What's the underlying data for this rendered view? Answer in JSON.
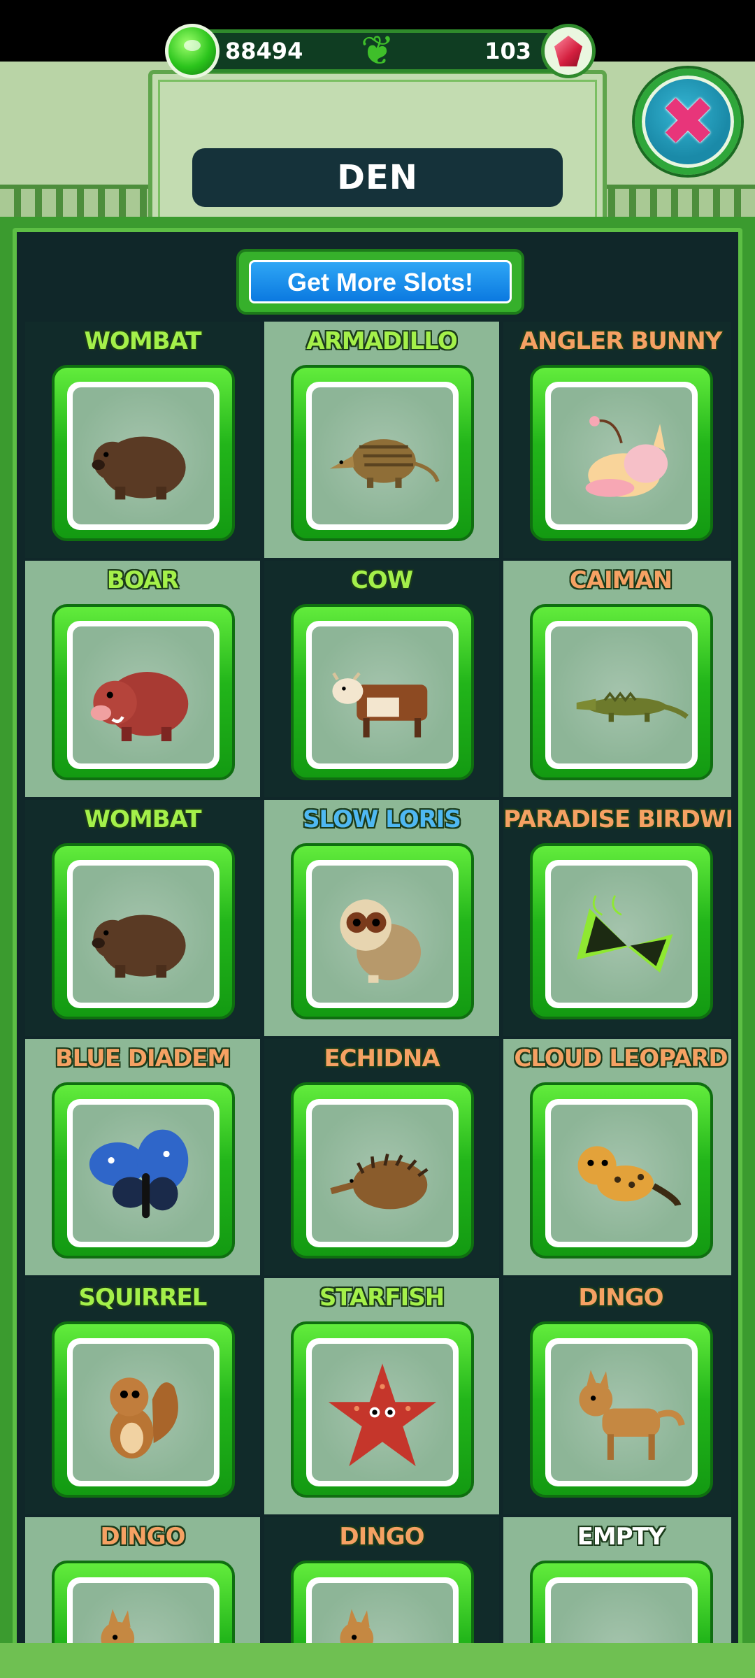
{
  "header": {
    "green_currency": "88494",
    "red_currency": "103",
    "title": "DEN"
  },
  "slots_button_label": "Get More Slots!",
  "animals": [
    {
      "name": "WOMBAT",
      "label_color": "green",
      "tone": "dark",
      "icon": "wombat-icon"
    },
    {
      "name": "ARMADILLO",
      "label_color": "green",
      "tone": "light",
      "icon": "armadillo-icon"
    },
    {
      "name": "ANGLER BUNNY",
      "label_color": "orange",
      "tone": "dark",
      "icon": "angler-bunny-icon"
    },
    {
      "name": "BOAR",
      "label_color": "green",
      "tone": "light",
      "icon": "boar-icon"
    },
    {
      "name": "COW",
      "label_color": "green",
      "tone": "dark",
      "icon": "cow-icon"
    },
    {
      "name": "CAIMAN",
      "label_color": "orange",
      "tone": "light",
      "icon": "caiman-icon"
    },
    {
      "name": "WOMBAT",
      "label_color": "green",
      "tone": "dark",
      "icon": "wombat-icon"
    },
    {
      "name": "SLOW LORIS",
      "label_color": "blue",
      "tone": "light",
      "icon": "slow-loris-icon"
    },
    {
      "name": "PARADISE BIRDWING",
      "label_color": "orange",
      "tone": "dark",
      "icon": "birdwing-icon"
    },
    {
      "name": "BLUE DIADEM",
      "label_color": "orange",
      "tone": "light",
      "icon": "blue-diadem-icon"
    },
    {
      "name": "ECHIDNA",
      "label_color": "orange",
      "tone": "dark",
      "icon": "echidna-icon"
    },
    {
      "name": "CLOUD LEOPARD",
      "label_color": "orange",
      "tone": "light",
      "icon": "cloud-leopard-icon"
    },
    {
      "name": "SQUIRREL",
      "label_color": "green",
      "tone": "dark",
      "icon": "squirrel-icon"
    },
    {
      "name": "STARFISH",
      "label_color": "green",
      "tone": "light",
      "icon": "starfish-icon"
    },
    {
      "name": "DINGO",
      "label_color": "orange",
      "tone": "dark",
      "icon": "dingo-icon"
    },
    {
      "name": "DINGO",
      "label_color": "orange",
      "tone": "light",
      "icon": "dingo-icon"
    },
    {
      "name": "DINGO",
      "label_color": "orange",
      "tone": "dark",
      "icon": "dingo-icon"
    },
    {
      "name": "EMPTY",
      "label_color": "white",
      "tone": "light",
      "icon": "empty-slot"
    }
  ],
  "colors": {
    "label_green": "#a4f04a",
    "label_orange": "#f5a163",
    "label_blue": "#4fb8f2",
    "label_white": "#ffffff",
    "card_green": "#22b51a",
    "panel_dark": "#112b2a",
    "panel_light": "#8db896"
  }
}
